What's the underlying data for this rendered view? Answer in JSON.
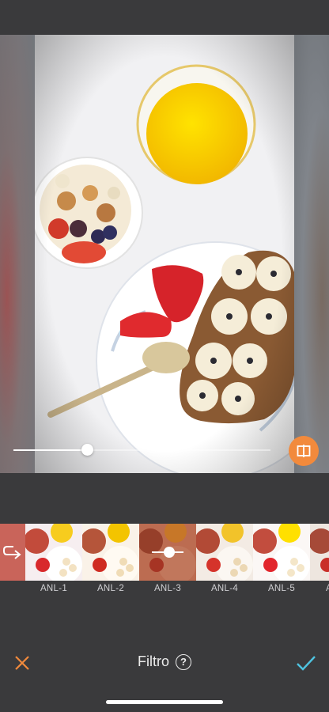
{
  "filters": [
    {
      "id": "back",
      "label": ""
    },
    {
      "id": "anl1",
      "label": "ANL-1"
    },
    {
      "id": "anl2",
      "label": "ANL-2"
    },
    {
      "id": "anl3",
      "label": "ANL-3"
    },
    {
      "id": "anl4",
      "label": "ANL-4"
    },
    {
      "id": "anl5",
      "label": "ANL-5"
    },
    {
      "id": "anl6",
      "label": "A"
    }
  ],
  "selected_filter": "ANL-3",
  "intensity_fraction": 0.27,
  "footer": {
    "title": "Filtro",
    "help_symbol": "?"
  },
  "colors": {
    "accent": "#f28a3c",
    "confirm": "#4ec3e0",
    "cancel": "#f28a3c"
  }
}
